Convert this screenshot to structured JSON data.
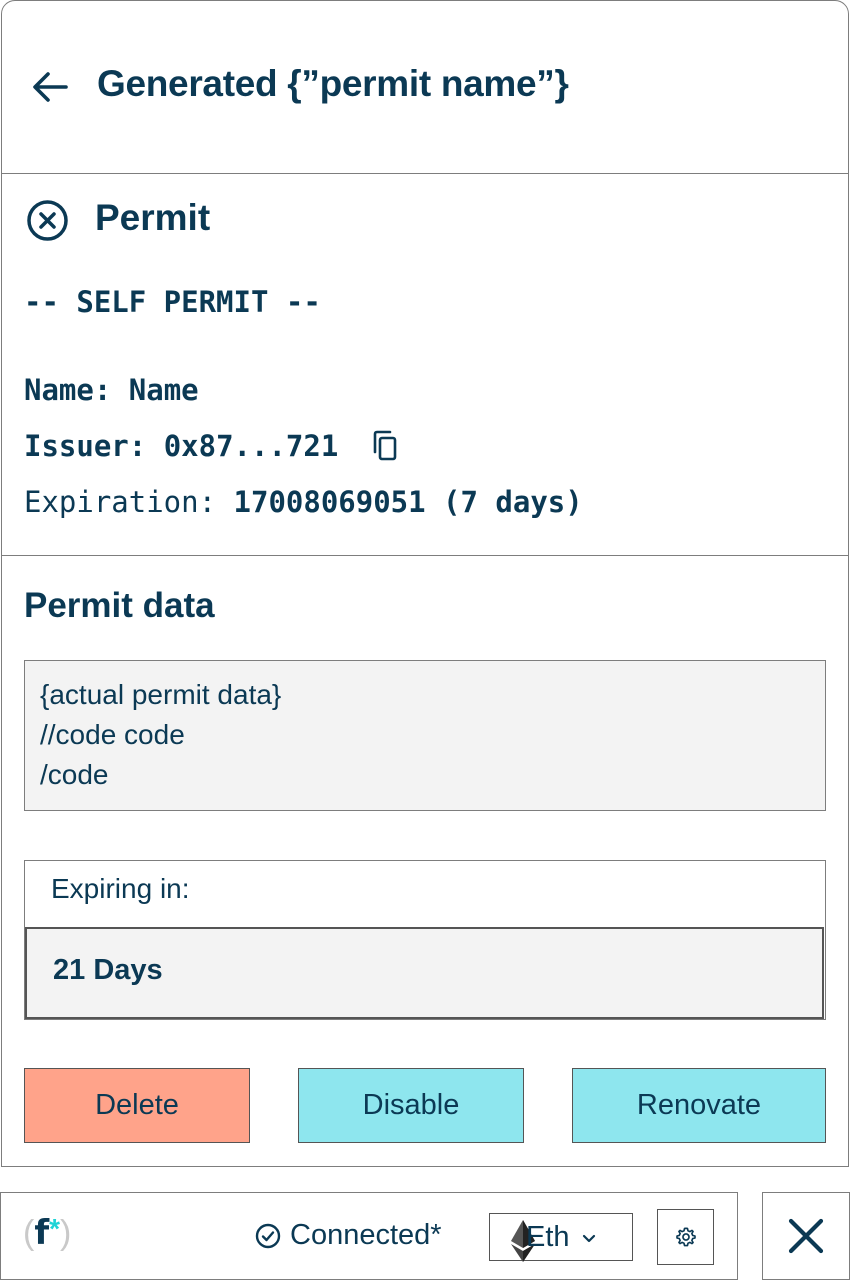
{
  "header": {
    "title": "Generated {”permit name”}",
    "back_icon": "arrow-left-icon"
  },
  "permit": {
    "title": "Permit",
    "close_icon": "close-circle-icon",
    "self_permit_label": "-- SELF PERMIT --",
    "name_label": "Name:",
    "name_value": "Name",
    "issuer_label": "Issuer:",
    "issuer_value": "0x87...721",
    "copy_icon": "copy-icon",
    "expiration_label": "Expiration:",
    "expiration_value": "17008069051 (7 days)"
  },
  "permit_data": {
    "title": "Permit data",
    "code_lines": [
      "{actual permit data}",
      "//code code",
      "/code"
    ]
  },
  "expiry": {
    "label": "Expiring in:",
    "value": "21 Days"
  },
  "actions": {
    "delete_label": "Delete",
    "disable_label": "Disable",
    "renovate_label": "Renovate",
    "delete_color": "#ffa38a",
    "disable_color": "#8ee6ee",
    "renovate_color": "#8ee6ee"
  },
  "footer": {
    "logo": {
      "open": "(",
      "letter": "f",
      "star": "*",
      "close": ")"
    },
    "status_icon": "check-circle-icon",
    "status_text": "Connected*",
    "network_icon": "ethereum-icon",
    "network_label": "Eth",
    "dropdown_icon": "chevron-down-icon",
    "settings_icon": "gear-icon",
    "close_icon": "close-icon"
  },
  "colors": {
    "text": "#0b3954",
    "accent": "#1fd3d6",
    "border": "#7d7d7d",
    "code_bg": "#f3f3f3"
  }
}
